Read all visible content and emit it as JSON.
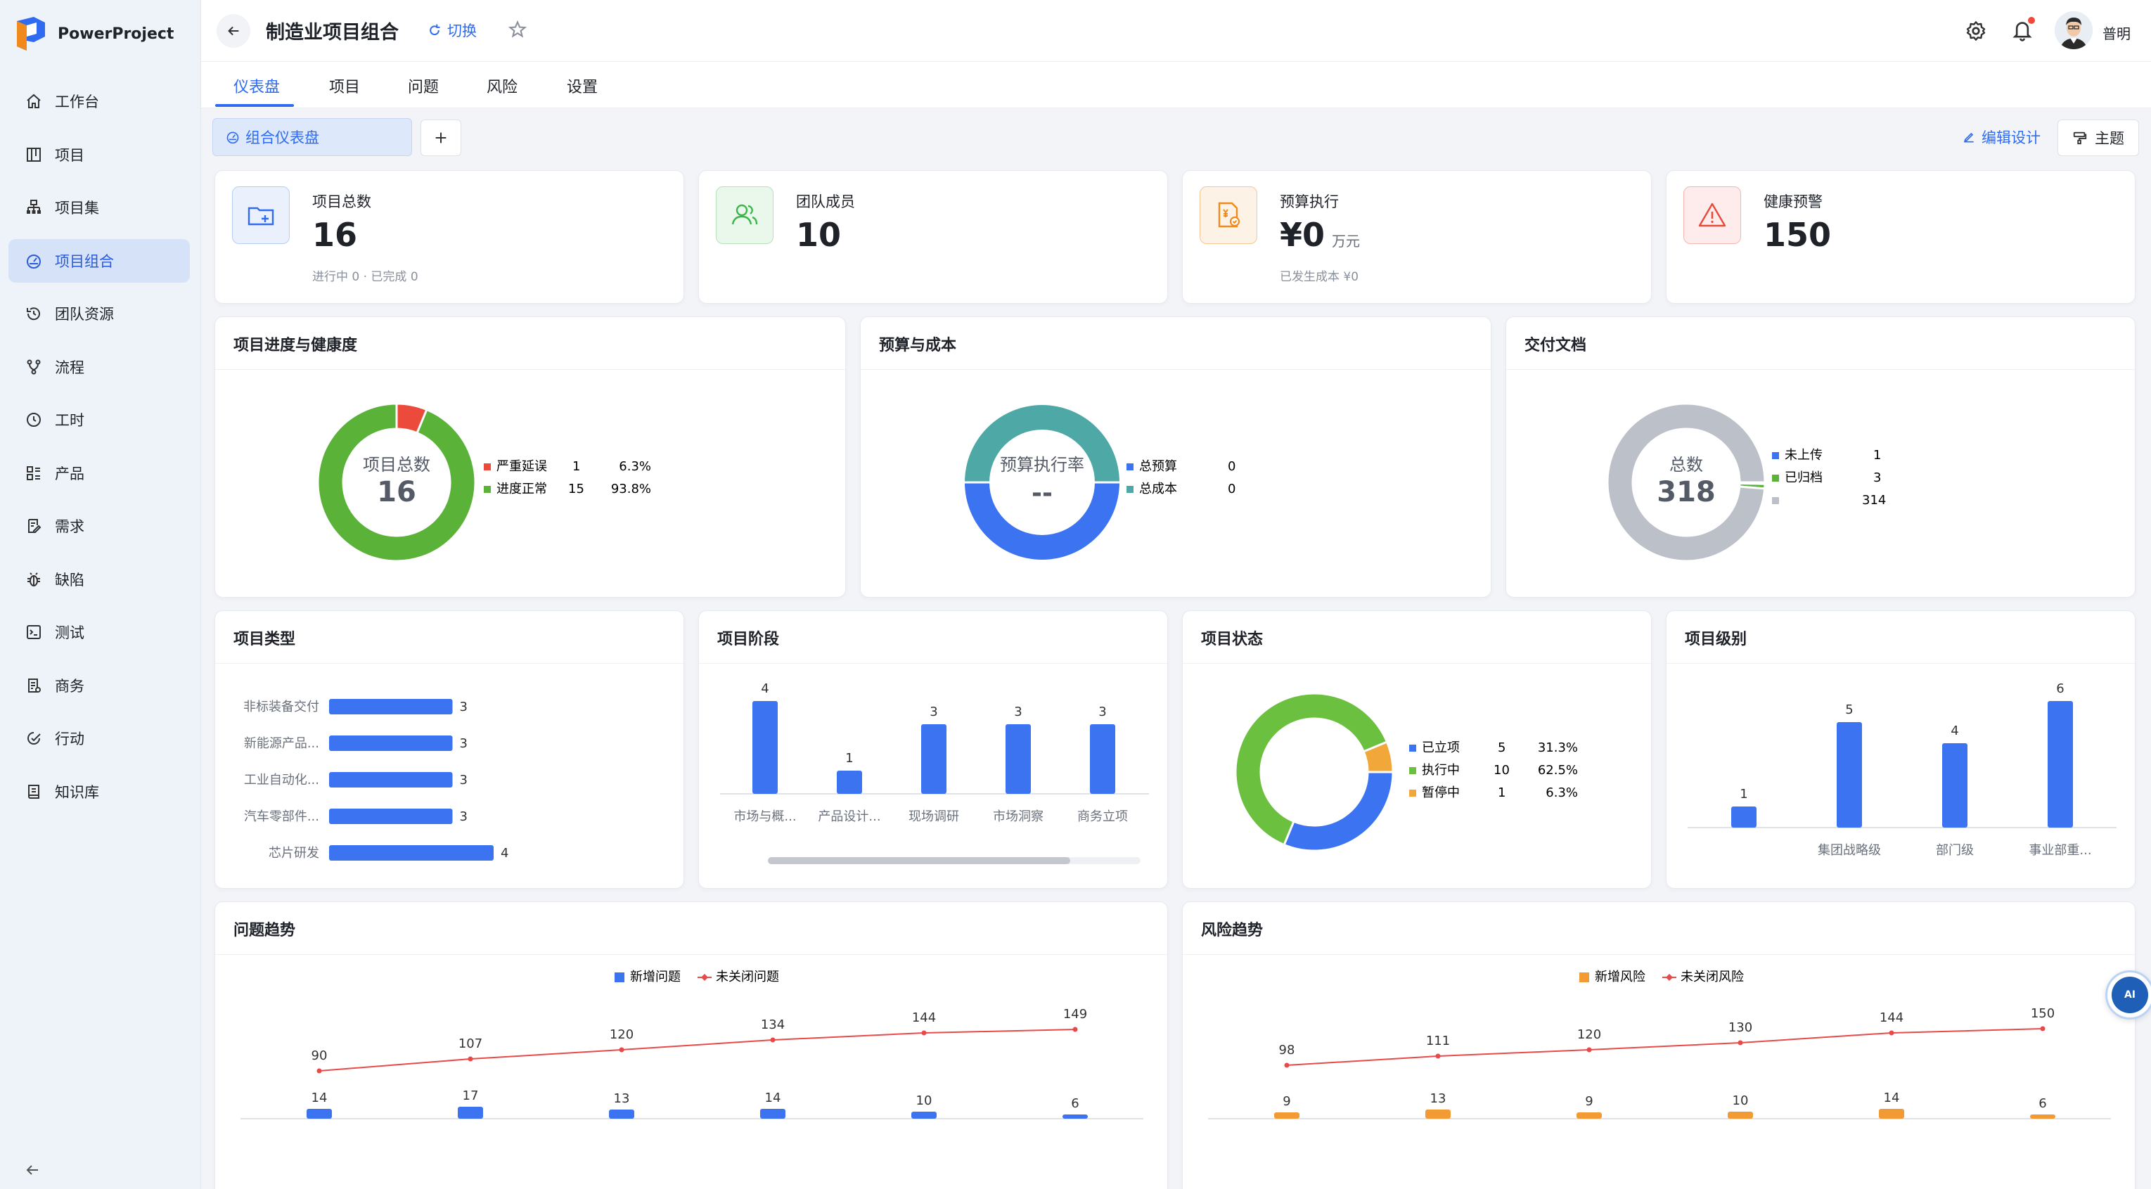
{
  "app": {
    "name": "PowerProject"
  },
  "sidebar": {
    "items": [
      {
        "label": "工作台",
        "icon": "home-icon"
      },
      {
        "label": "项目",
        "icon": "board-icon"
      },
      {
        "label": "项目集",
        "icon": "hierarchy-icon"
      },
      {
        "label": "项目组合",
        "icon": "dashboard-icon"
      },
      {
        "label": "团队资源",
        "icon": "history-icon"
      },
      {
        "label": "流程",
        "icon": "branch-icon"
      },
      {
        "label": "工时",
        "icon": "clock-icon"
      },
      {
        "label": "产品",
        "icon": "grid-list-icon"
      },
      {
        "label": "需求",
        "icon": "doc-edit-icon"
      },
      {
        "label": "缺陷",
        "icon": "bug-icon"
      },
      {
        "label": "测试",
        "icon": "terminal-icon"
      },
      {
        "label": "商务",
        "icon": "receipt-icon"
      },
      {
        "label": "行动",
        "icon": "action-icon"
      },
      {
        "label": "知识库",
        "icon": "book-icon"
      }
    ],
    "active_index": 3
  },
  "header": {
    "title": "制造业项目组合",
    "switch_label": "切换",
    "user_name": "普明"
  },
  "tabs": [
    {
      "label": "仪表盘"
    },
    {
      "label": "项目"
    },
    {
      "label": "问题"
    },
    {
      "label": "风险"
    },
    {
      "label": "设置"
    }
  ],
  "toolbar": {
    "dashboard_chip": "组合仪表盘",
    "add_label": "+",
    "edit_design": "编辑设计",
    "theme": "主题"
  },
  "kpis": [
    {
      "label": "项目总数",
      "value": "16",
      "unit": "",
      "sub": "进行中 0  ·  已完成 0",
      "icon": "folder-plus-icon",
      "color": "#2f6bf0"
    },
    {
      "label": "团队成员",
      "value": "10",
      "unit": "",
      "sub": "",
      "icon": "team-icon",
      "color": "#3bb54a"
    },
    {
      "label": "预算执行",
      "value": "¥0",
      "unit": "万元",
      "sub": "已发生成本 ¥0",
      "icon": "budget-doc-icon",
      "color": "#f08a1c"
    },
    {
      "label": "健康预警",
      "value": "150",
      "unit": "",
      "sub": "",
      "icon": "warning-icon",
      "color": "#e64a3b"
    }
  ],
  "charts": {
    "health": {
      "title": "项目进度与健康度",
      "center_label": "项目总数",
      "center_value": "16",
      "legend": [
        {
          "name": "严重延误",
          "count": "1",
          "pct": "6.3%"
        },
        {
          "name": "进度正常",
          "count": "15",
          "pct": "93.8%"
        }
      ]
    },
    "budget": {
      "title": "预算与成本",
      "center_label": "预算执行率",
      "center_value": "--",
      "legend": [
        {
          "name": "总预算",
          "count": "0"
        },
        {
          "name": "总成本",
          "count": "0"
        }
      ]
    },
    "docs": {
      "title": "交付文档",
      "center_label": "总数",
      "center_value": "318",
      "legend": [
        {
          "name": "未上传",
          "count": "1"
        },
        {
          "name": "已归档",
          "count": "3"
        },
        {
          "name": "",
          "count": "314"
        }
      ]
    },
    "type": {
      "title": "项目类型"
    },
    "stage": {
      "title": "项目阶段"
    },
    "status": {
      "title": "项目状态",
      "legend": [
        {
          "name": "已立项",
          "count": "5",
          "pct": "31.3%"
        },
        {
          "name": "执行中",
          "count": "10",
          "pct": "62.5%"
        },
        {
          "name": "暂停中",
          "count": "1",
          "pct": "6.3%"
        }
      ]
    },
    "level": {
      "title": "项目级别"
    },
    "issues": {
      "title": "问题趋势",
      "legend_bar": "新增问题",
      "legend_line": "未关闭问题"
    },
    "risks": {
      "title": "风险趋势",
      "legend_bar": "新增风险",
      "legend_line": "未关闭风险"
    }
  },
  "chart_data": [
    {
      "type": "pie",
      "title": "项目进度与健康度",
      "categories": [
        "严重延误",
        "进度正常"
      ],
      "values": [
        1,
        15
      ],
      "colors": [
        "#ec4a3a",
        "#5ab238"
      ]
    },
    {
      "type": "pie",
      "title": "预算与成本",
      "categories": [
        "总预算",
        "总成本"
      ],
      "values": [
        0,
        0
      ],
      "colors": [
        "#3b73f0",
        "#4ea8a6"
      ]
    },
    {
      "type": "pie",
      "title": "交付文档",
      "categories": [
        "未上传",
        "已归档",
        ""
      ],
      "values": [
        1,
        3,
        314
      ],
      "colors": [
        "#3b73f0",
        "#5ab238",
        "#bcc0c8"
      ]
    },
    {
      "type": "bar",
      "title": "项目类型",
      "orientation": "horizontal",
      "categories": [
        "非标装备交付",
        "新能源产品...",
        "工业自动化...",
        "汽车零部件...",
        "芯片研发"
      ],
      "values": [
        3,
        3,
        3,
        3,
        4
      ],
      "color": "#3b73f0"
    },
    {
      "type": "bar",
      "title": "项目阶段",
      "categories": [
        "市场与概...",
        "产品设计...",
        "现场调研",
        "市场洞察",
        "商务立项"
      ],
      "values": [
        4,
        1,
        3,
        3,
        3
      ],
      "color": "#3b73f0"
    },
    {
      "type": "pie",
      "title": "项目状态",
      "categories": [
        "已立项",
        "执行中",
        "暂停中"
      ],
      "values": [
        5,
        10,
        1
      ],
      "colors": [
        "#3b73f0",
        "#6cc040",
        "#f2a73a"
      ]
    },
    {
      "type": "bar",
      "title": "项目级别",
      "categories": [
        "",
        "集团战略级",
        "部门级",
        "事业部重..."
      ],
      "values": [
        1,
        5,
        4,
        6
      ],
      "color": "#3b73f0"
    },
    {
      "type": "line",
      "title": "问题趋势",
      "series": [
        {
          "name": "新增问题",
          "type": "bar",
          "values": [
            14,
            17,
            13,
            14,
            10,
            6
          ],
          "color": "#3b73f0"
        },
        {
          "name": "未关闭问题",
          "type": "line",
          "values": [
            90,
            107,
            120,
            134,
            144,
            149
          ],
          "color": "#e84a4a"
        }
      ]
    },
    {
      "type": "line",
      "title": "风险趋势",
      "series": [
        {
          "name": "新增风险",
          "type": "bar",
          "values": [
            9,
            13,
            9,
            10,
            14,
            6
          ],
          "color": "#f29a33"
        },
        {
          "name": "未关闭风险",
          "type": "line",
          "values": [
            98,
            111,
            120,
            130,
            144,
            150
          ],
          "color": "#e84a4a"
        }
      ]
    }
  ]
}
